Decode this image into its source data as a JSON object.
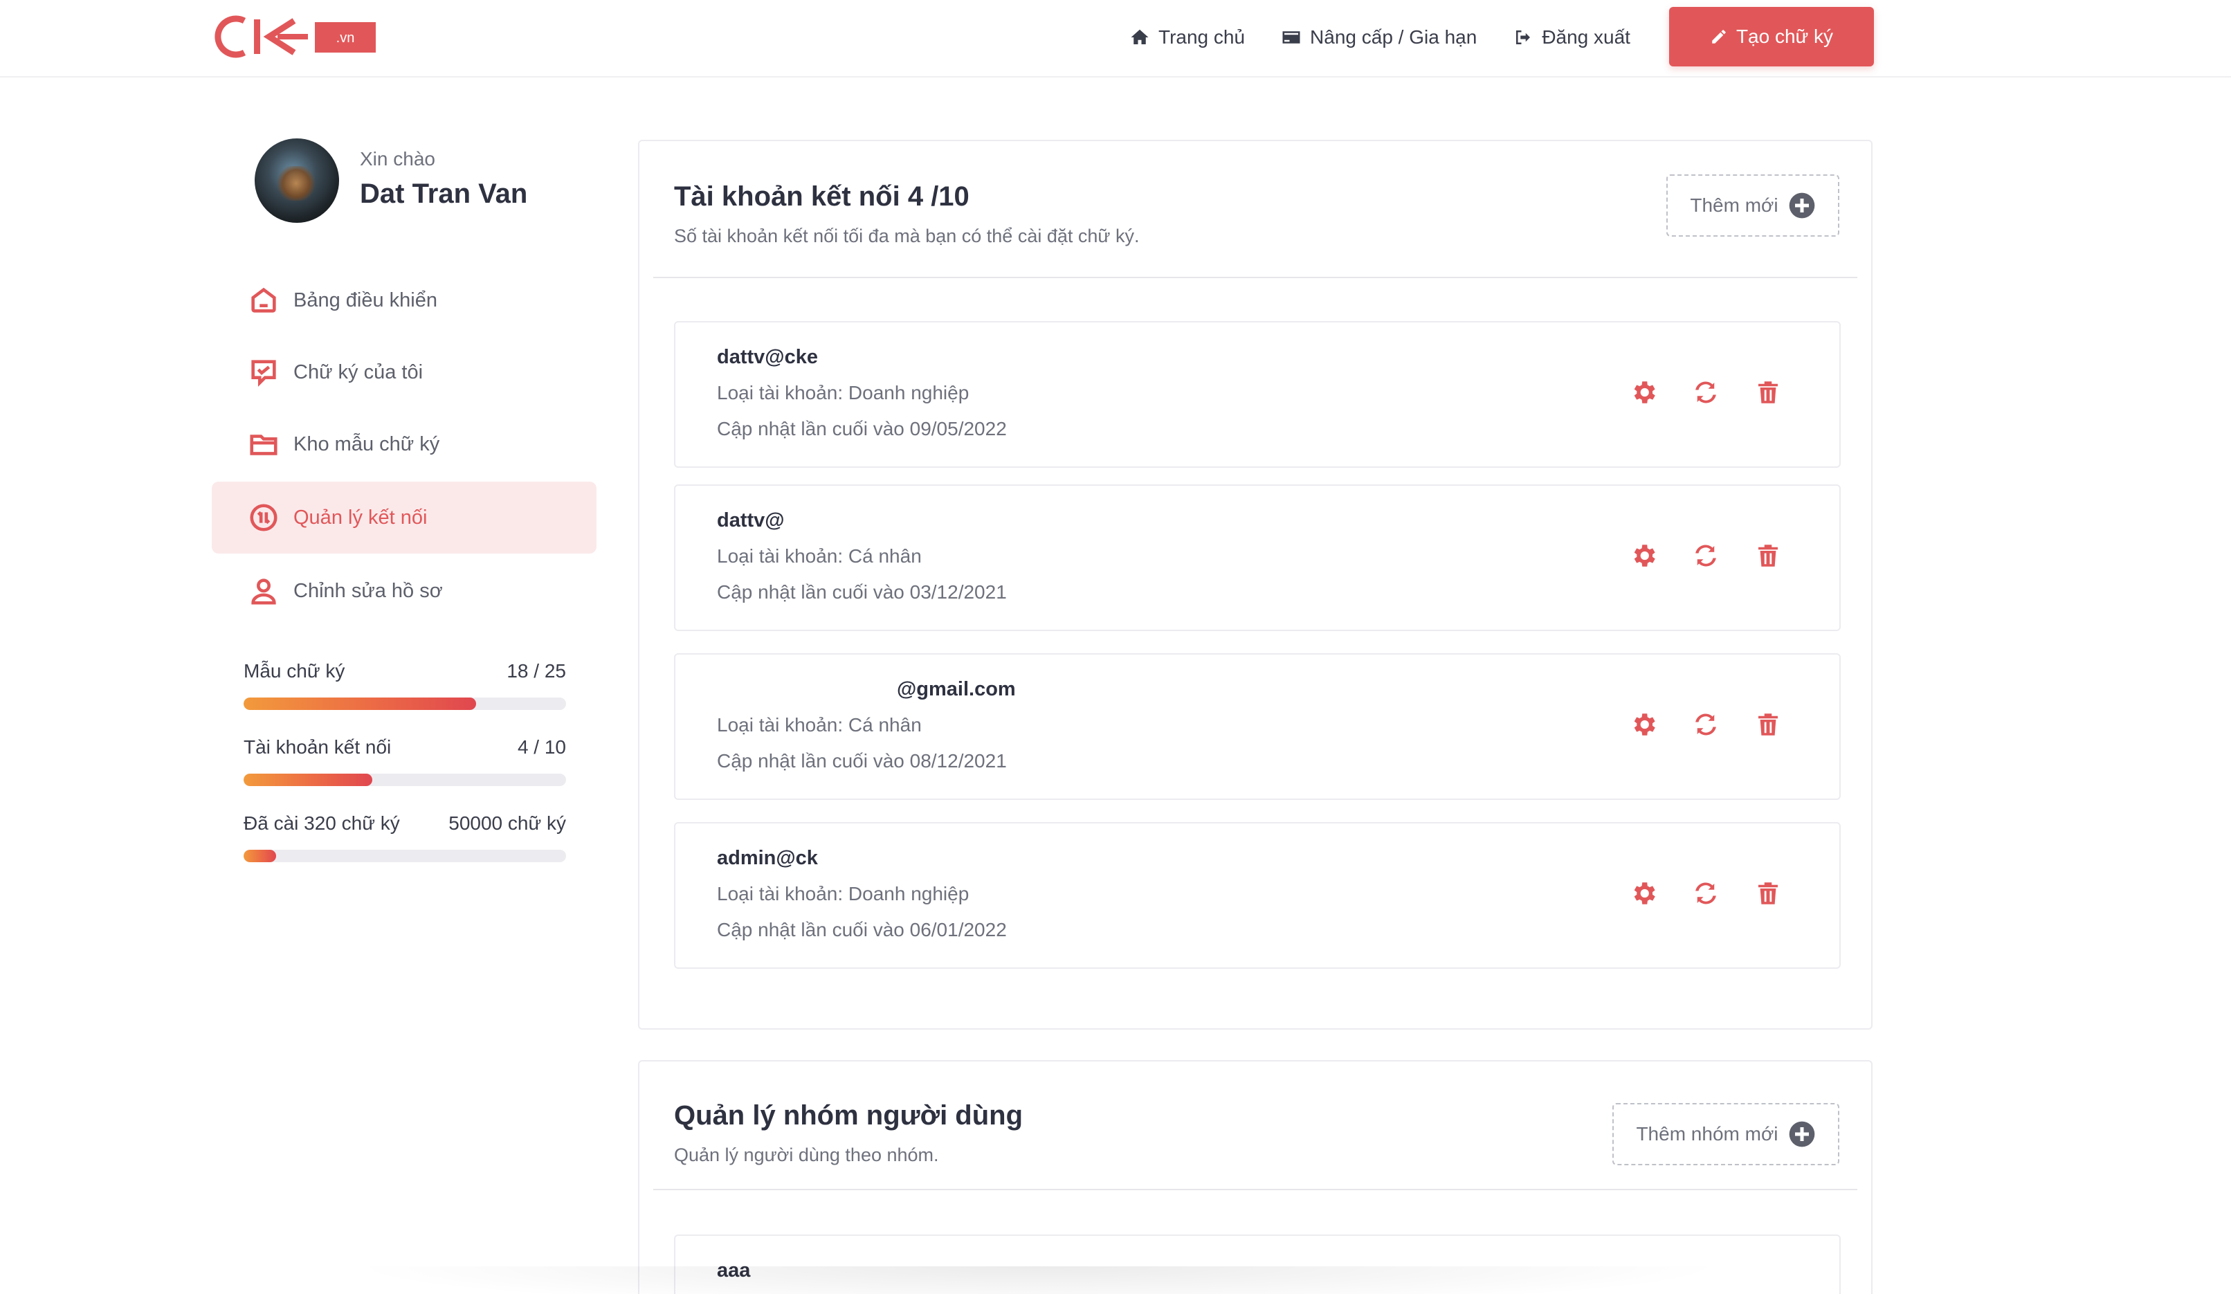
{
  "brand": {
    "logo_text": "CK",
    "logo_badge": ".vn",
    "accent": "#e15759"
  },
  "nav": {
    "home": "Trang chủ",
    "upgrade": "Nâng cấp / Gia hạn",
    "logout": "Đăng xuất",
    "create": "Tạo chữ ký"
  },
  "profile": {
    "greeting": "Xin chào",
    "name": "Dat Tran Van"
  },
  "sidebar": {
    "items": [
      {
        "label": "Bảng điều khiển",
        "icon": "home-icon"
      },
      {
        "label": "Chữ ký của tôi",
        "icon": "signature-chat-icon"
      },
      {
        "label": "Kho mẫu chữ ký",
        "icon": "folder-icon"
      },
      {
        "label": "Quản lý kết nối",
        "icon": "connection-icon",
        "active": true
      },
      {
        "label": "Chỉnh sửa hồ sơ",
        "icon": "user-icon"
      }
    ]
  },
  "stats": [
    {
      "label": "Mẫu chữ ký",
      "value": "18 / 25",
      "fraction": 0.72
    },
    {
      "label": "Tài khoản kết nối",
      "value": "4 / 10",
      "fraction": 0.4
    },
    {
      "label": "Đã cài 320 chữ ký",
      "value": "50000 chữ ký",
      "fraction": 0.0064
    }
  ],
  "accounts_section": {
    "title": "Tài khoản kết nối 4 /10",
    "subtitle": "Số tài khoản kết nối tối đa mà bạn có thể cài đặt chữ ký.",
    "add_label": "Thêm mới",
    "accounts": [
      {
        "name": "dattv@cke",
        "type": "Loại tài khoản: Doanh nghiệp",
        "updated": "Cập nhật lần cuối vào 09/05/2022"
      },
      {
        "name": "dattv@",
        "type": "Loại tài khoản: Cá nhân",
        "updated": "Cập nhật lần cuối vào 03/12/2021"
      },
      {
        "name": "@gmail.com",
        "type": "Loại tài khoản: Cá nhân",
        "updated": "Cập nhật lần cuối vào 08/12/2021"
      },
      {
        "name": "admin@ck",
        "type": "Loại tài khoản: Doanh nghiệp",
        "updated": "Cập nhật lần cuối vào 06/01/2022"
      }
    ]
  },
  "groups_section": {
    "title": "Quản lý nhóm người dùng",
    "subtitle": "Quản lý người dùng theo nhóm.",
    "add_label": "Thêm nhóm mới",
    "groups": [
      {
        "name": "aaa"
      }
    ]
  }
}
